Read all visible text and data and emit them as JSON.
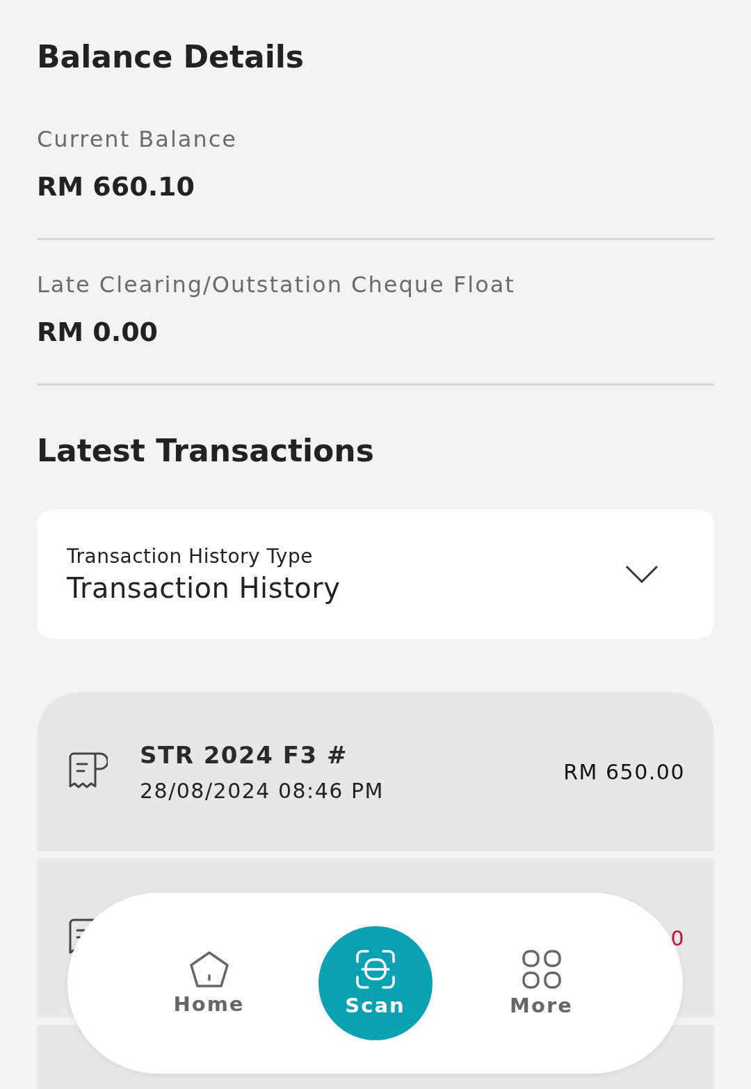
{
  "title": "Balance Details",
  "balances": [
    {
      "label": "Current Balance",
      "value": "RM 660.10"
    },
    {
      "label": "Late Clearing/Outstation Cheque Float",
      "value": "RM 0.00"
    }
  ],
  "section_title": "Latest Transactions",
  "dropdown": {
    "label": "Transaction History Type",
    "value": "Transaction History"
  },
  "transactions": [
    {
      "title": "STR 2024 F3 #",
      "datetime": "28/08/2024 08:46 PM",
      "amount": "RM 650.00",
      "color": "#111111"
    },
    {
      "amount": "0",
      "color": "#c8102e"
    }
  ],
  "nav": [
    {
      "label": "Home",
      "kind": "home",
      "selected": false
    },
    {
      "label": "Scan",
      "kind": "scan",
      "selected": true
    },
    {
      "label": "More",
      "kind": "more",
      "selected": false
    }
  ]
}
